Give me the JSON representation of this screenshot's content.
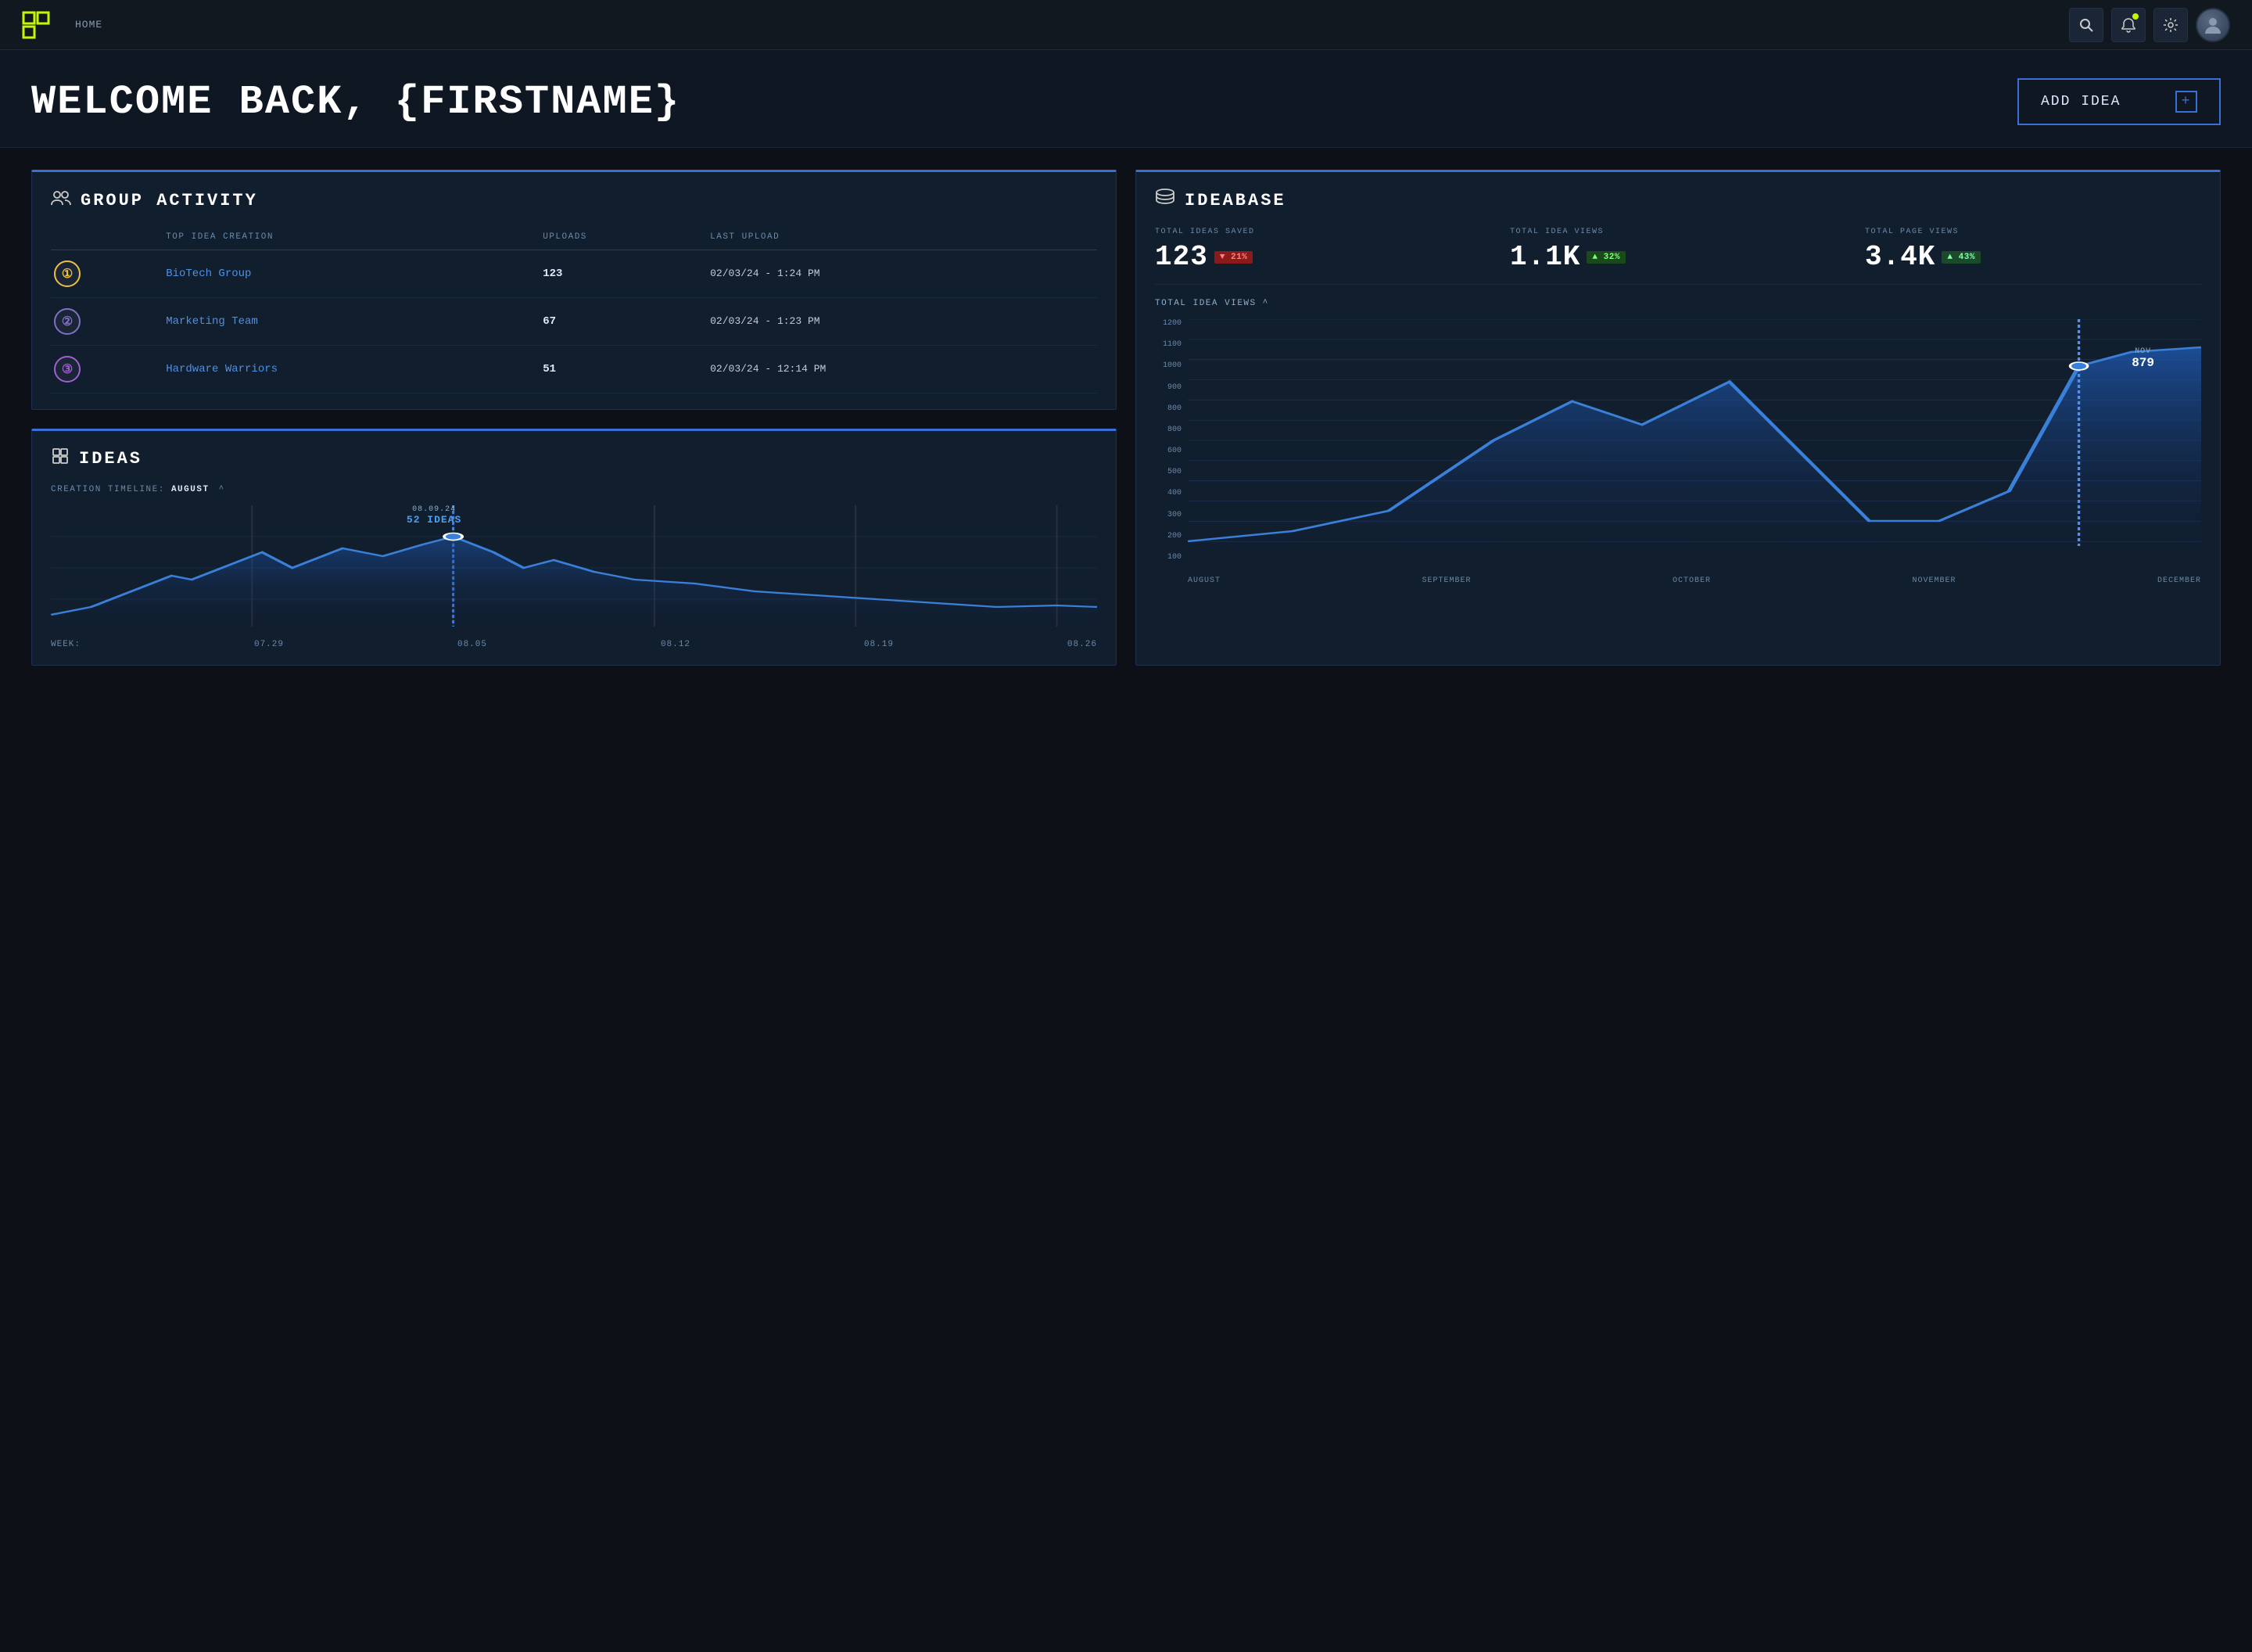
{
  "navbar": {
    "logo_alt": "App Logo",
    "home_label": "HOME",
    "search_title": "Search",
    "notifications_title": "Notifications",
    "settings_title": "Settings",
    "avatar_title": "User Avatar"
  },
  "hero": {
    "welcome_text": "WELCOME BACK, {FIRSTNAME}",
    "add_idea_label": "ADD IDEA",
    "plus_symbol": "+"
  },
  "group_activity": {
    "card_title": "GROUP ACTIVITY",
    "col_top_idea": "TOP IDEA CREATION",
    "col_uploads": "UPLOADS",
    "col_last_upload": "LAST UPLOAD",
    "rows": [
      {
        "rank": "1",
        "name": "BioTech Group",
        "uploads": "123",
        "last_upload": "02/03/24 - 1:24 PM"
      },
      {
        "rank": "2",
        "name": "Marketing Team",
        "uploads": "67",
        "last_upload": "02/03/24 - 1:23 PM"
      },
      {
        "rank": "3",
        "name": "Hardware Warriors",
        "uploads": "51",
        "last_upload": "02/03/24 - 12:14 PM"
      }
    ]
  },
  "ideas": {
    "card_title": "IDEAS",
    "timeline_prefix": "CREATION TIMELINE:",
    "timeline_month": "AUGUST",
    "timeline_caret": "^",
    "tooltip_date": "08.09.24",
    "tooltip_count": "52 IDEAS",
    "week_labels": [
      "07.29",
      "08.05",
      "08.12",
      "08.19",
      "08.26"
    ],
    "week_prefix": "WEEK:"
  },
  "ideabase": {
    "card_title": "IDEABASE",
    "stats": [
      {
        "label": "TOTAL IDEAS SAVED",
        "value": "123",
        "badge": "▼ 21%",
        "badge_type": "down"
      },
      {
        "label": "TOTAL IDEA VIEWS",
        "value": "1.1K",
        "badge": "▲ 32%",
        "badge_type": "up"
      },
      {
        "label": "TOTAL PAGE VIEWS",
        "value": "3.4K",
        "badge": "▲ 43%",
        "badge_type": "up2"
      }
    ],
    "chart_label": "TOTAL IDEA VIEWS",
    "chart_caret": "^",
    "tooltip_month": "NOV",
    "tooltip_value": "879",
    "y_labels": [
      "1200",
      "1100",
      "1000",
      "900",
      "800",
      "800",
      "600",
      "500",
      "400",
      "300",
      "200",
      "100"
    ],
    "x_labels": [
      "AUGUST",
      "SEPTEMBER",
      "OCTOBER",
      "NOVEMBER",
      "DECEMBER"
    ]
  }
}
